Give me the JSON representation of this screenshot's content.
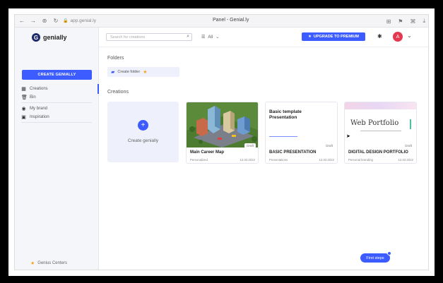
{
  "browser": {
    "url": "app.genial.ly",
    "tab_title": "Panel - Genial.ly"
  },
  "sidebar": {
    "brand": "genially",
    "create_button": "CREATE GENIALLY",
    "items": [
      {
        "label": "Creations",
        "icon": "grid-icon"
      },
      {
        "label": "Bin",
        "icon": "trash-icon"
      },
      {
        "label": "My brand",
        "icon": "palette-icon"
      },
      {
        "label": "Inspiration",
        "icon": "image-icon"
      }
    ],
    "footer": "Genius Centers"
  },
  "topbar": {
    "search_placeholder": "Search for creations",
    "filter_label": "All",
    "upgrade_label": "UPGRADE TO PREMIUM",
    "avatar_initial": "A"
  },
  "main": {
    "folders_heading": "Folders",
    "create_folder": "Create folder",
    "creations_heading": "Creations",
    "new_card_label": "Create genially",
    "cards": [
      {
        "title": "Main Career Map",
        "category": "Personalized",
        "date": "12.02.2022",
        "status": "Draft"
      },
      {
        "title": "BASIC PRESENTATION",
        "category": "Presentations",
        "date": "12.02.2022",
        "status": "Draft",
        "thumb_title": "Basic template Presentation"
      },
      {
        "title": "DIGITAL DESIGN PORTFOLIO",
        "category": "Personal branding",
        "date": "12.02.2022",
        "status": "Draft",
        "thumb_title": "Web Portfolio"
      }
    ],
    "first_steps": "First steps"
  },
  "colors": {
    "accent": "#3d5cff",
    "avatar": "#e5384f",
    "star": "#f2a623"
  }
}
